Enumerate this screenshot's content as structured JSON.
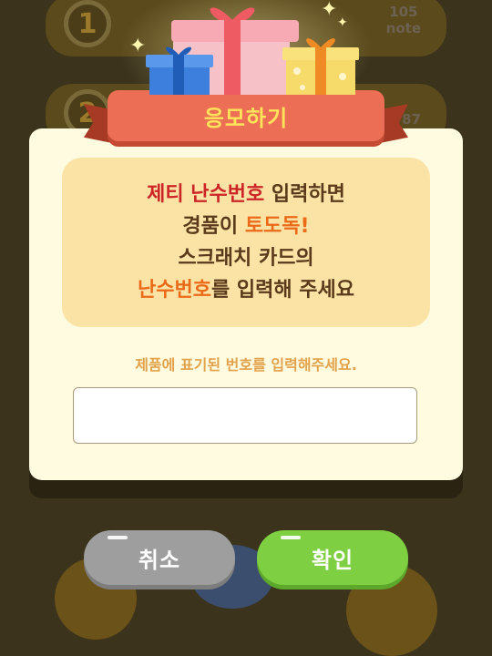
{
  "background": {
    "rows": [
      {
        "number": "1",
        "note": "105\nnote"
      },
      {
        "number": "2",
        "note": "87"
      }
    ]
  },
  "dialog": {
    "title": "응모하기",
    "info": {
      "line1": {
        "highlight": "제티 난수번호",
        "rest": " 입력하면"
      },
      "line2": {
        "text": "경품이 ",
        "highlight": "토도독!"
      },
      "line3": {
        "text": "스크래치 카드의"
      },
      "line4": {
        "highlight": "난수번호",
        "rest": "를 입력해 주세요"
      }
    },
    "hint": "제품에 표기된 번호를 입력해주세요.",
    "input": {
      "value": "",
      "placeholder": ""
    }
  },
  "buttons": {
    "cancel": "취소",
    "confirm": "확인"
  },
  "colors": {
    "ribbon": "#ec6e54",
    "title_text": "#ffe35a",
    "confirm_button": "#7fcf42",
    "cancel_button": "#9e9e9e",
    "highlight_red": "#cc2525",
    "highlight_orange": "#ea6a18"
  }
}
